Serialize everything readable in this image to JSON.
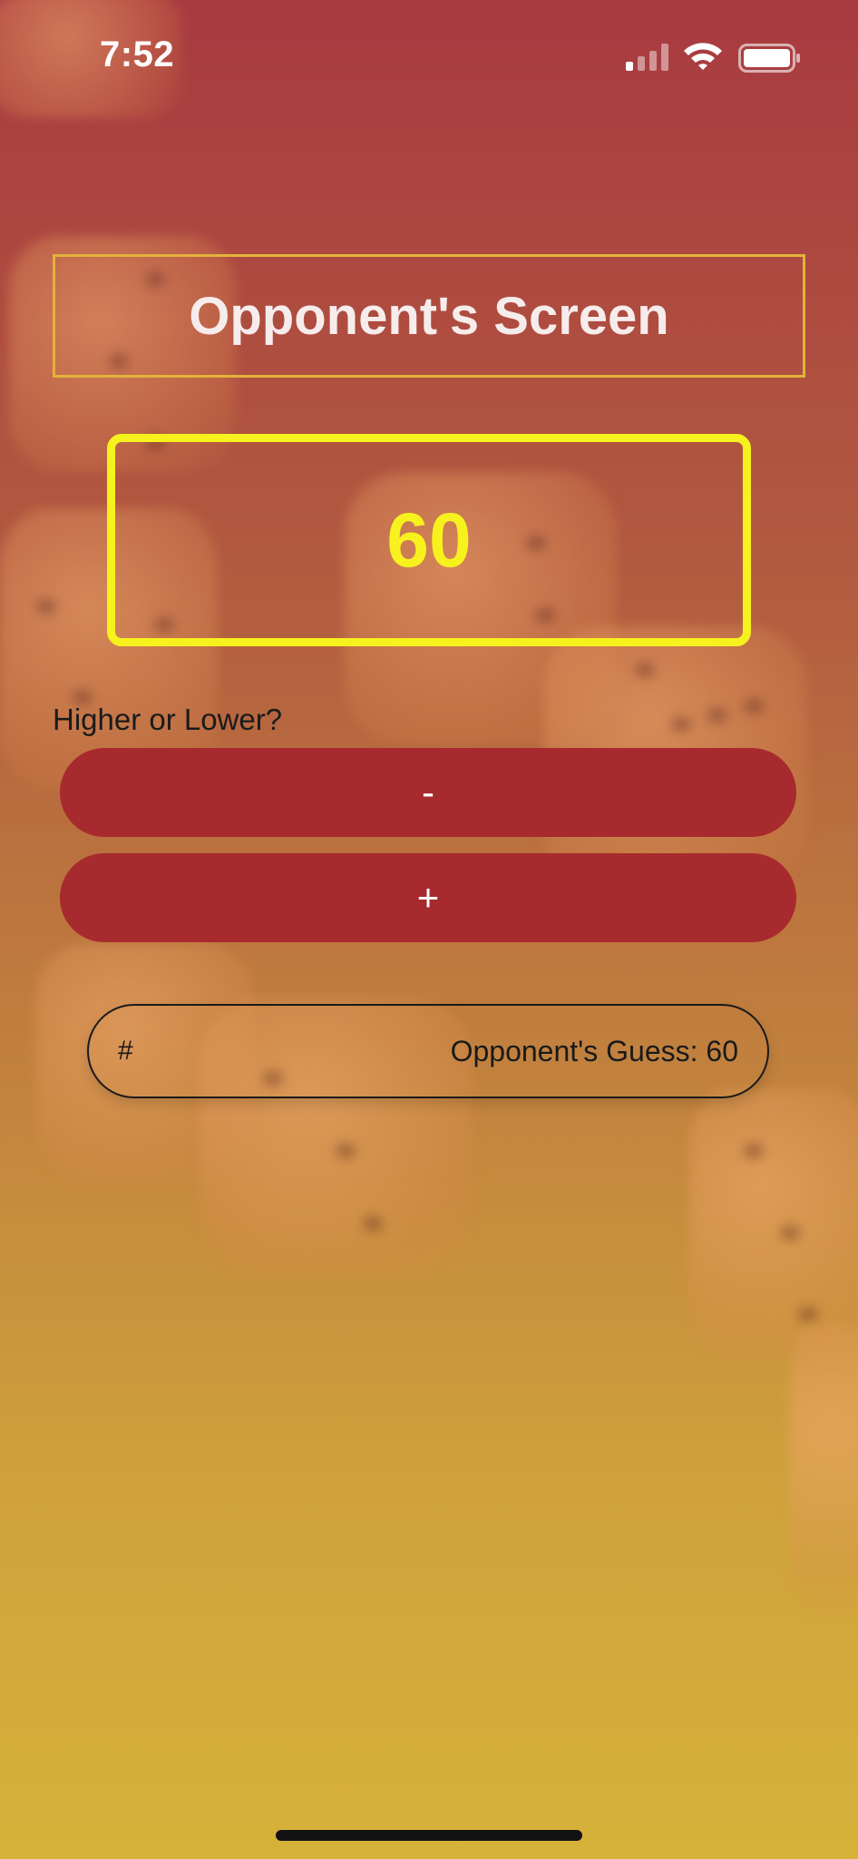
{
  "status_bar": {
    "time": "7:52",
    "signal_icon": "cellular-signal-icon",
    "wifi_icon": "wifi-icon",
    "battery_icon": "battery-icon"
  },
  "screen": {
    "title": "Opponent's Screen",
    "current_number": "60",
    "prompt": "Higher or Lower?"
  },
  "buttons": {
    "lower_label": "-",
    "higher_label": "+"
  },
  "guess_field": {
    "prefix": "#",
    "text": "Opponent's Guess: 60"
  },
  "colors": {
    "accent_yellow": "#f7f21e",
    "title_border": "#e2b33a",
    "button_red": "#a62a2e",
    "background_top": "#a83a40",
    "background_bottom": "#d6b23a"
  }
}
